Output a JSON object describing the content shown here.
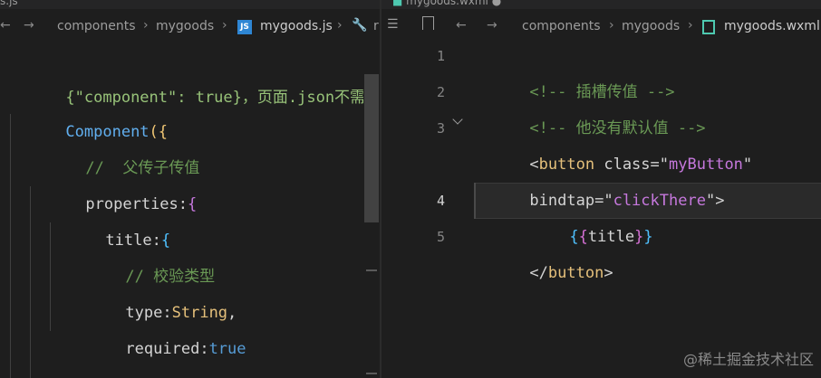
{
  "left": {
    "tab_name": "s.js",
    "breadcrumb": {
      "folder1": "components",
      "folder2": "mygoods",
      "file_badge": "JS",
      "file": "mygoods.js",
      "more": "r"
    },
    "lines": [
      {
        "text": "{\"component\": true}，页面.json不需要"
      },
      {
        "kw": "Component",
        "brace": "({"
      },
      {
        "comment": "//  父传子传值"
      },
      {
        "key": "properties",
        "colon": ":",
        "brace": "{"
      },
      {
        "key": "title",
        "colon": ":",
        "brace": "{"
      },
      {
        "comment": "// 校验类型"
      },
      {
        "key": "type",
        "colon": ":",
        "value": "String",
        "comma": ","
      },
      {
        "key": "required",
        "colon": ":",
        "value": "true"
      },
      {
        "brace": "}"
      }
    ]
  },
  "right": {
    "tab_name": "mygoods.wxml",
    "tab_modified": "●",
    "breadcrumb": {
      "folder1": "components",
      "folder2": "mygoods",
      "file": "mygoods.wxml"
    },
    "line_numbers": [
      "1",
      "2",
      "3",
      "4",
      "5"
    ],
    "lines": [
      {
        "comment": "<!-- 插槽传值 -->"
      },
      {
        "comment": "<!-- 他没有默认值 -->"
      },
      {
        "open": "<",
        "tag": "button",
        "attr": "class",
        "eq": "=",
        "q1": "\"",
        "val": "myButton",
        "q2": "\""
      },
      {
        "attr": "bindtap",
        "eq": "=",
        "q1": "\"",
        "val": "clickThere",
        "q2": "\"",
        "close": ">"
      },
      {
        "b1": "{",
        "b2": "{",
        "expr": "title",
        "b3": "}",
        "b4": "}"
      },
      {
        "open": "</",
        "tag": "button",
        "close": ">"
      }
    ]
  },
  "watermark": "@稀土掘金技术社区"
}
